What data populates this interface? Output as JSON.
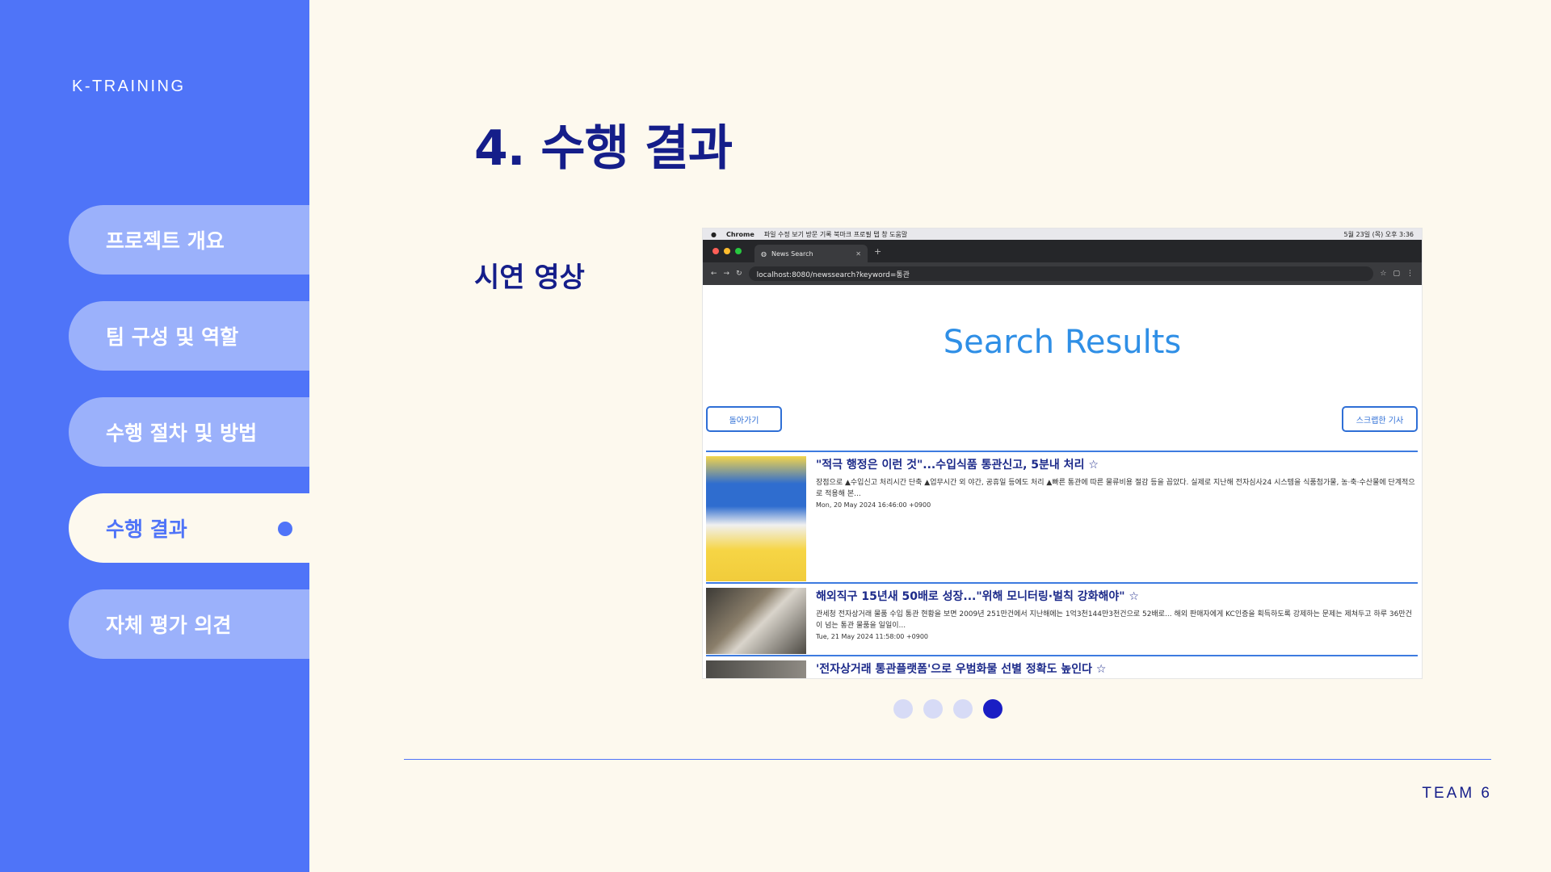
{
  "sidebar": {
    "brand": "K-TRAINING",
    "items": [
      {
        "label": "프로젝트 개요"
      },
      {
        "label": "팀 구성 및 역할"
      },
      {
        "label": "수행 절차 및 방법"
      },
      {
        "label": "수행 결과"
      },
      {
        "label": "자체 평가 의견"
      }
    ],
    "active_index": 3
  },
  "main": {
    "title": "4. 수행 결과",
    "subtitle": "시연 영상"
  },
  "screenshot": {
    "menubar": {
      "app": "Chrome",
      "menus": "파일   수정   보기   방문 기록   북마크   프로필   탭   창   도움말",
      "datetime": "5월 23일 (목) 오후 3:36"
    },
    "tab_title": "News Search",
    "url": "localhost:8080/newssearch?keyword=통관",
    "heading": "Search Results",
    "back_button": "돌아가기",
    "scrap_button": "스크랩한 기사",
    "results": [
      {
        "title": "\"적극 행정은 이런 것\"...수입식품 통관신고, 5분내 처리 ☆",
        "desc": "장점으로 ▲수입신고 처리시간 단축 ▲업무시간 외 야간, 공휴일 등에도 처리 ▲빠른 통관에 따른 물류비용 절감 등을 꼽았다. 실제로 지난해 전자심사24 시스템을 식품첨가물, 농·축·수산물에 단계적으로 적용해 본...",
        "date": "Mon, 20 May 2024 16:46:00 +0900"
      },
      {
        "title": "해외직구 15년새 50배로 성장...\"위해 모니터링·벌칙 강화해야\" ☆",
        "desc": "관세청 전자상거래 물품 수입 통관 현황을 보면 2009년 251만건에서 지난해에는 1억3천144만3천건으로 52배로... 해외 판매자에게 KC인증을 획득하도록 강제하는 문제는 제쳐두고 하루 36만건이 넘는 통관 물품을 일일이...",
        "date": "Tue, 21 May 2024 11:58:00 +0900"
      },
      {
        "title": "'전자상거래 통관플랫폼'으로 우범화물 선별 정확도 높인다 ☆"
      }
    ]
  },
  "pagination": {
    "count": 4,
    "active_index": 3
  },
  "footer": {
    "team": "TEAM 6"
  },
  "colors": {
    "sidebar": "#4f74f8",
    "nav_pill": "#9bb1fb",
    "background": "#fdf9ee",
    "title": "#151e8a",
    "search_heading": "#2f8fe6",
    "dot_active": "#1a1ec4",
    "dot_inactive": "#d7dbf6"
  }
}
